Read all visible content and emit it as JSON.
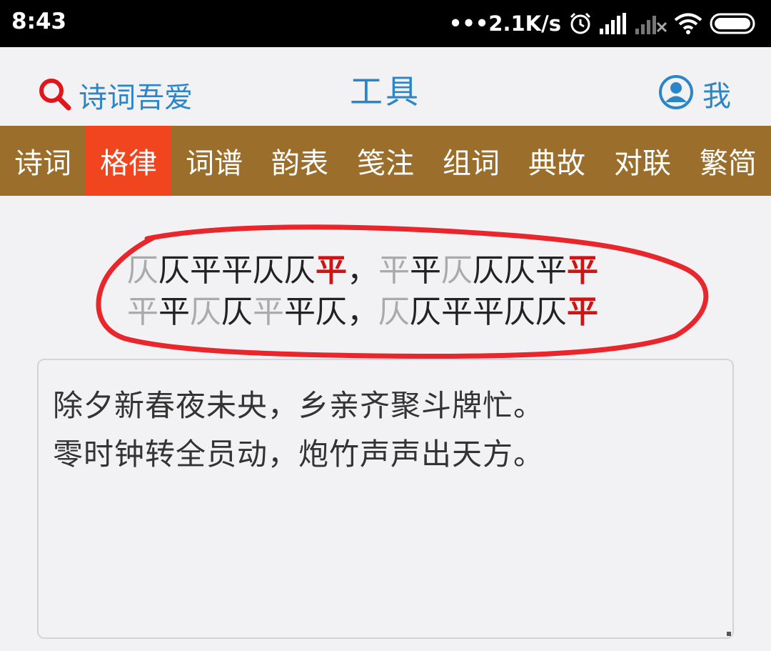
{
  "status_bar": {
    "time": "8:43",
    "network_speed": "•••2.1K/s",
    "icons": [
      "alarm-icon",
      "signal-icon",
      "signal-off-icon",
      "wifi-icon",
      "battery-icon"
    ]
  },
  "header": {
    "search_label": "诗词吾爱",
    "title": "工具",
    "me_label": "我"
  },
  "nav": {
    "tabs": [
      {
        "label": "诗词",
        "active": false
      },
      {
        "label": "格律",
        "active": true
      },
      {
        "label": "词谱",
        "active": false
      },
      {
        "label": "韵表",
        "active": false
      },
      {
        "label": "笺注",
        "active": false
      },
      {
        "label": "组词",
        "active": false
      },
      {
        "label": "典故",
        "active": false
      },
      {
        "label": "对联",
        "active": false
      },
      {
        "label": "繁简",
        "active": false
      }
    ]
  },
  "meter": {
    "lines": [
      [
        {
          "t": "仄",
          "s": "light"
        },
        {
          "t": "仄",
          "s": "dark"
        },
        {
          "t": "平",
          "s": "dark"
        },
        {
          "t": "平",
          "s": "dark"
        },
        {
          "t": "仄",
          "s": "dark"
        },
        {
          "t": "仄",
          "s": "dark"
        },
        {
          "t": "平",
          "s": "rhyme"
        },
        {
          "t": "，",
          "s": "punct"
        },
        {
          "t": "平",
          "s": "light"
        },
        {
          "t": "平",
          "s": "dark"
        },
        {
          "t": "仄",
          "s": "light"
        },
        {
          "t": "仄",
          "s": "dark"
        },
        {
          "t": "仄",
          "s": "dark"
        },
        {
          "t": "平",
          "s": "dark"
        },
        {
          "t": "平",
          "s": "rhyme"
        }
      ],
      [
        {
          "t": "平",
          "s": "light"
        },
        {
          "t": "平",
          "s": "dark"
        },
        {
          "t": "仄",
          "s": "light"
        },
        {
          "t": "仄",
          "s": "dark"
        },
        {
          "t": "平",
          "s": "light"
        },
        {
          "t": "平",
          "s": "dark"
        },
        {
          "t": "仄",
          "s": "dark"
        },
        {
          "t": "，",
          "s": "punct"
        },
        {
          "t": "仄",
          "s": "light"
        },
        {
          "t": "仄",
          "s": "dark"
        },
        {
          "t": "平",
          "s": "dark"
        },
        {
          "t": "平",
          "s": "dark"
        },
        {
          "t": "仄",
          "s": "dark"
        },
        {
          "t": "仄",
          "s": "dark"
        },
        {
          "t": "平",
          "s": "rhyme"
        }
      ]
    ]
  },
  "poem": {
    "lines": [
      "除夕新春夜未央，乡亲齐聚斗牌忙。",
      "零时钟转全员动，炮竹声声出天方。"
    ]
  },
  "colors": {
    "accent_blue": "#2a86c7",
    "nav_bg": "#9b6f2b",
    "nav_active": "#f0451e",
    "rhyme_red": "#d01414",
    "annotation_red": "#e8262c"
  }
}
